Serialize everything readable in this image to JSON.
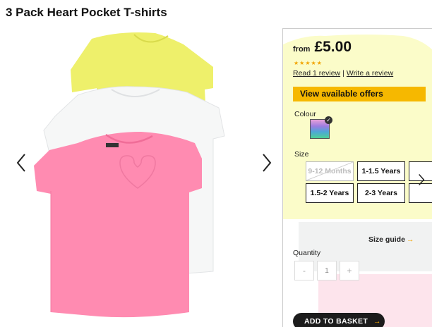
{
  "product": {
    "title": "3 Pack Heart Pocket T-shirts"
  },
  "gallery": {
    "prev_icon": "chevron-left-icon",
    "next_icon": "chevron-right-icon",
    "image_description_items": [
      "yellow t-shirt",
      "white t-shirt",
      "pink heart pocket t-shirt"
    ]
  },
  "pricing": {
    "from_label": "from",
    "price": "£5.00",
    "stars": "★★★★★",
    "rating": 5,
    "read_reviews": "Read 1 review",
    "separator": "|",
    "write_review": "Write a review"
  },
  "offers": {
    "label": "View available offers",
    "color": "#f6b800"
  },
  "colour": {
    "label": "Colour",
    "selected_icon": "check-icon",
    "check_glyph": "✓"
  },
  "size": {
    "label": "Size",
    "options": [
      {
        "label": "9-12 Months",
        "available": false
      },
      {
        "label": "1-1.5 Years",
        "available": true
      },
      {
        "label": "1.5-2 Years",
        "available": true
      },
      {
        "label": "2-3 Years",
        "available": true
      }
    ],
    "next_icon": "chevron-right-icon"
  },
  "size_guide": {
    "label": "Size guide",
    "arrow": "→"
  },
  "quantity": {
    "label": "Quantity",
    "minus": "-",
    "value": "1",
    "plus": "+"
  },
  "basket": {
    "label": "ADD TO BASKET",
    "arrow": "→"
  },
  "colors": {
    "accent": "#f6b800",
    "star": "#f2a400",
    "button_dark": "#1c1c1c"
  }
}
